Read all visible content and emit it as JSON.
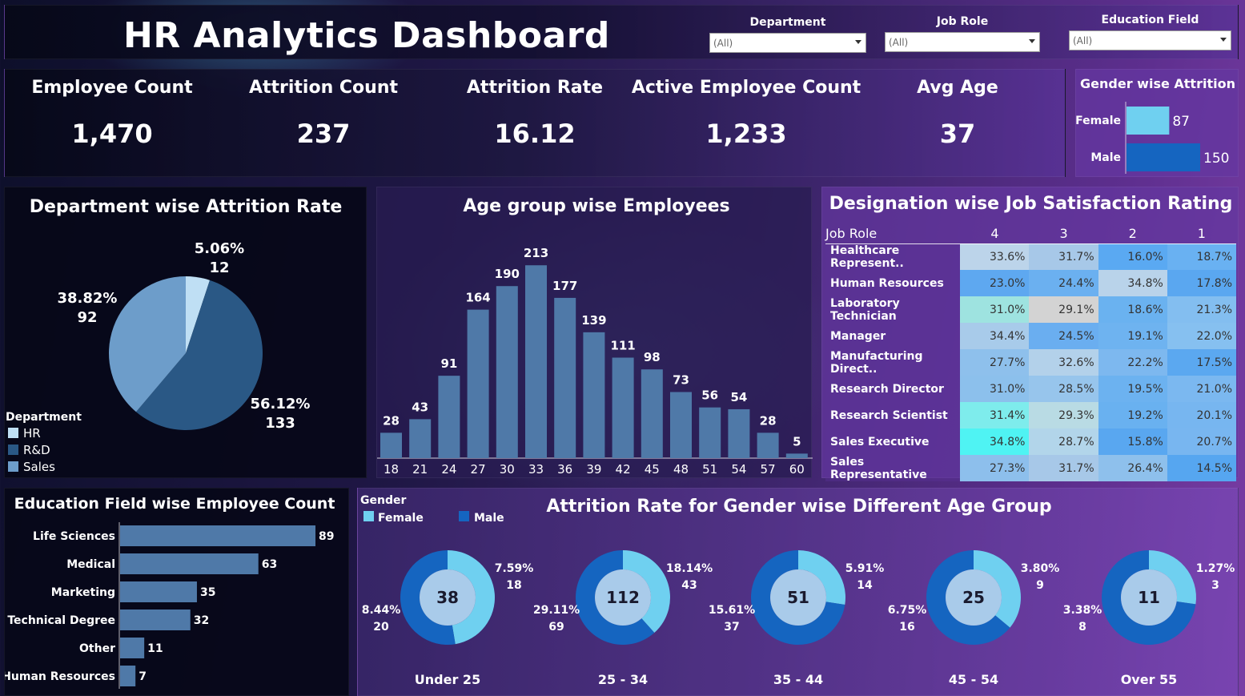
{
  "header": {
    "title": "HR Analytics Dashboard",
    "filters": [
      {
        "label": "Department",
        "value": "(All)"
      },
      {
        "label": "Job Role",
        "value": "(All)"
      },
      {
        "label": "Education Field",
        "value": "(All)"
      }
    ]
  },
  "kpis": [
    {
      "label": "Employee Count",
      "value": "1,470"
    },
    {
      "label": "Attrition Count",
      "value": "237"
    },
    {
      "label": "Attrition Rate",
      "value": "16.12"
    },
    {
      "label": "Active Employee Count",
      "value": "1,233"
    },
    {
      "label": "Avg Age",
      "value": "37"
    }
  ],
  "colors": {
    "light_blue": "#6fd0f0",
    "mid_blue": "#1565c0",
    "bar_blue": "#4f79a8",
    "pie_hr": "#bfdff4",
    "pie_rd": "#2a5885",
    "pie_sales": "#6d9dca",
    "donut_inner": "#a9cbea"
  },
  "chart_data": [
    {
      "type": "bar",
      "title": "Gender wise Attrition",
      "orientation": "horizontal",
      "categories": [
        "Female",
        "Male"
      ],
      "values": [
        87,
        150
      ],
      "data_labels": [
        "87",
        "150"
      ]
    },
    {
      "type": "pie",
      "title": "Department wise Attrition Rate",
      "legend_title": "Department",
      "legend_position": "bottom-left",
      "categories": [
        "HR",
        "R&D",
        "Sales"
      ],
      "values": [
        12,
        133,
        92
      ],
      "percent_labels": [
        "5.06%",
        "56.12%",
        "38.82%"
      ],
      "count_labels": [
        "12",
        "133",
        "92"
      ]
    },
    {
      "type": "bar",
      "title": "Age group wise Employees",
      "categories": [
        "18",
        "21",
        "24",
        "27",
        "30",
        "33",
        "36",
        "39",
        "42",
        "45",
        "48",
        "51",
        "54",
        "57",
        "60"
      ],
      "values": [
        28,
        43,
        91,
        164,
        190,
        213,
        177,
        139,
        111,
        98,
        73,
        56,
        54,
        28,
        5
      ],
      "ylim": [
        0,
        230
      ]
    },
    {
      "type": "table",
      "title": "Designation wise Job Satisfaction Rating",
      "columns": [
        "Job Role",
        "4",
        "3",
        "2",
        "1"
      ],
      "rows": [
        {
          "role": "Healthcare Represent..",
          "values": [
            "33.6%",
            "31.7%",
            "16.0%",
            "18.7%"
          ],
          "colors": [
            "#bcd4ea",
            "#a7c8e8",
            "#5aa9f2",
            "#69b1f2"
          ]
        },
        {
          "role": "Human Resources",
          "values": [
            "23.0%",
            "24.4%",
            "34.8%",
            "17.8%"
          ],
          "colors": [
            "#5ea8f0",
            "#6bb0f0",
            "#b9d3ea",
            "#5aa7f0"
          ]
        },
        {
          "role": "Laboratory Technician",
          "values": [
            "31.0%",
            "29.1%",
            "18.6%",
            "21.3%"
          ],
          "colors": [
            "#9ee3e0",
            "#d3d3d3",
            "#6ab2f0",
            "#83bef0"
          ]
        },
        {
          "role": "Manager",
          "values": [
            "34.4%",
            "24.5%",
            "19.1%",
            "22.0%"
          ],
          "colors": [
            "#a8cbea",
            "#6aaef0",
            "#6eb3f0",
            "#86c0f0"
          ]
        },
        {
          "role": "Manufacturing Direct..",
          "values": [
            "27.7%",
            "32.6%",
            "22.2%",
            "17.5%"
          ],
          "colors": [
            "#8ec0ec",
            "#b3d1ea",
            "#7db8ef",
            "#5ba8f0"
          ]
        },
        {
          "role": "Research Director",
          "values": [
            "31.0%",
            "28.5%",
            "19.5%",
            "21.0%"
          ],
          "colors": [
            "#8cc0ec",
            "#97c5ec",
            "#6cb2f0",
            "#7bb8f0"
          ]
        },
        {
          "role": "Research Scientist",
          "values": [
            "31.4%",
            "29.3%",
            "19.2%",
            "20.1%"
          ],
          "colors": [
            "#7eecec",
            "#b9dbe4",
            "#69b1f0",
            "#77b6f0"
          ]
        },
        {
          "role": "Sales Executive",
          "values": [
            "34.8%",
            "28.7%",
            "15.8%",
            "20.7%"
          ],
          "colors": [
            "#4ff3f3",
            "#b2d5ea",
            "#59a7f0",
            "#78b6f0"
          ]
        },
        {
          "role": "Sales Representative",
          "values": [
            "27.3%",
            "31.7%",
            "26.4%",
            "14.5%"
          ],
          "colors": [
            "#8dbfec",
            "#a7c8e8",
            "#8ec0ec",
            "#56a6f0"
          ]
        }
      ]
    },
    {
      "type": "bar",
      "title": "Education Field wise Employee Count",
      "orientation": "horizontal",
      "categories": [
        "Life Sciences",
        "Medical",
        "Marketing",
        "Technical Degree",
        "Other",
        "Human Resources"
      ],
      "values": [
        89,
        63,
        35,
        32,
        11,
        7
      ]
    },
    {
      "type": "pie",
      "title": "Attrition Rate for Gender wise Different Age Group",
      "legend_title": "Gender",
      "legend": [
        "Female",
        "Male"
      ],
      "groups": [
        {
          "name": "Under 25",
          "total": "38",
          "female": 18,
          "male": 20,
          "female_pct": "7.59%",
          "male_pct": "8.44%"
        },
        {
          "name": "25 - 34",
          "total": "112",
          "female": 43,
          "male": 69,
          "female_pct": "18.14%",
          "male_pct": "29.11%"
        },
        {
          "name": "35 - 44",
          "total": "51",
          "female": 14,
          "male": 37,
          "female_pct": "5.91%",
          "male_pct": "15.61%"
        },
        {
          "name": "45 - 54",
          "total": "25",
          "female": 9,
          "male": 16,
          "female_pct": "3.80%",
          "male_pct": "6.75%"
        },
        {
          "name": "Over 55",
          "total": "11",
          "female": 3,
          "male": 8,
          "female_pct": "1.27%",
          "male_pct": "3.38%"
        }
      ]
    }
  ]
}
